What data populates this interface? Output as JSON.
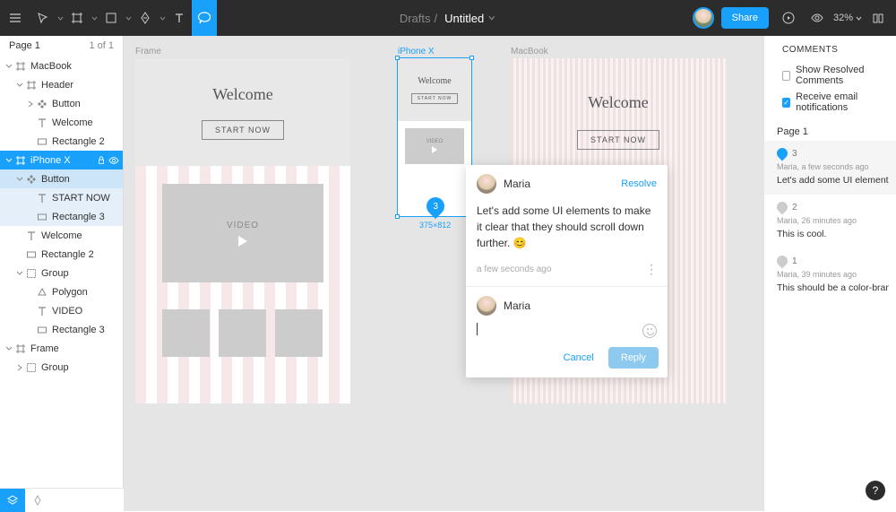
{
  "toolbar": {
    "breadcrumb": "Drafts",
    "title": "Untitled",
    "share": "Share",
    "zoom": "32%"
  },
  "pages": {
    "title": "Page 1",
    "count": "1 of 1"
  },
  "layers": [
    {
      "label": "MacBook",
      "icon": "frame",
      "indent": 0,
      "chev": "down"
    },
    {
      "label": "Header",
      "icon": "frame",
      "indent": 1,
      "chev": "down"
    },
    {
      "label": "Button",
      "icon": "component",
      "indent": 2,
      "chev": "right"
    },
    {
      "label": "Welcome",
      "icon": "text",
      "indent": 2
    },
    {
      "label": "Rectangle 2",
      "icon": "rect",
      "indent": 2
    },
    {
      "label": "iPhone X",
      "icon": "frame",
      "indent": 0,
      "chev": "down",
      "sel": "sel"
    },
    {
      "label": "Button",
      "icon": "component",
      "indent": 1,
      "chev": "down",
      "sel": "sel-soft"
    },
    {
      "label": "START NOW",
      "icon": "text",
      "indent": 2,
      "sel": "sel-softer"
    },
    {
      "label": "Rectangle 3",
      "icon": "rect",
      "indent": 2,
      "sel": "sel-softer"
    },
    {
      "label": "Welcome",
      "icon": "text",
      "indent": 1
    },
    {
      "label": "Rectangle 2",
      "icon": "rect",
      "indent": 1
    },
    {
      "label": "Group",
      "icon": "group",
      "indent": 1,
      "chev": "down"
    },
    {
      "label": "Polygon",
      "icon": "polygon",
      "indent": 2
    },
    {
      "label": "VIDEO",
      "icon": "text",
      "indent": 2
    },
    {
      "label": "Rectangle 3",
      "icon": "rect",
      "indent": 2
    },
    {
      "label": "Frame",
      "icon": "frame",
      "indent": 0,
      "chev": "down"
    },
    {
      "label": "Group",
      "icon": "group",
      "indent": 1,
      "chev": "right"
    }
  ],
  "canvas": {
    "frame_labels": {
      "frame": "Frame",
      "iphone": "iPhone X",
      "macbook": "MacBook",
      "dim": "375×812"
    },
    "artboard_text": {
      "welcome": "Welcome",
      "start": "START NOW",
      "video": "VIDEO"
    },
    "pin": "3"
  },
  "popover": {
    "author": "Maria",
    "resolve": "Resolve",
    "body": "Let's add some UI elements to make it clear that they should scroll down further. 😊",
    "meta": "a few seconds ago",
    "reply_author": "Maria",
    "cancel": "Cancel",
    "reply": "Reply"
  },
  "right": {
    "title": "COMMENTS",
    "show_resolved": "Show Resolved Comments",
    "receive_email": "Receive email notifications",
    "section": "Page 1",
    "comments": [
      {
        "num": "3",
        "meta": "Maria, a few seconds ago",
        "text": "Let's add some UI elements to make it",
        "active": true
      },
      {
        "num": "2",
        "meta": "Maria, 26 minutes ago",
        "text": "This is cool."
      },
      {
        "num": "1",
        "meta": "Maria, 39 minutes ago",
        "text": "This should be a color-branded button"
      }
    ]
  }
}
